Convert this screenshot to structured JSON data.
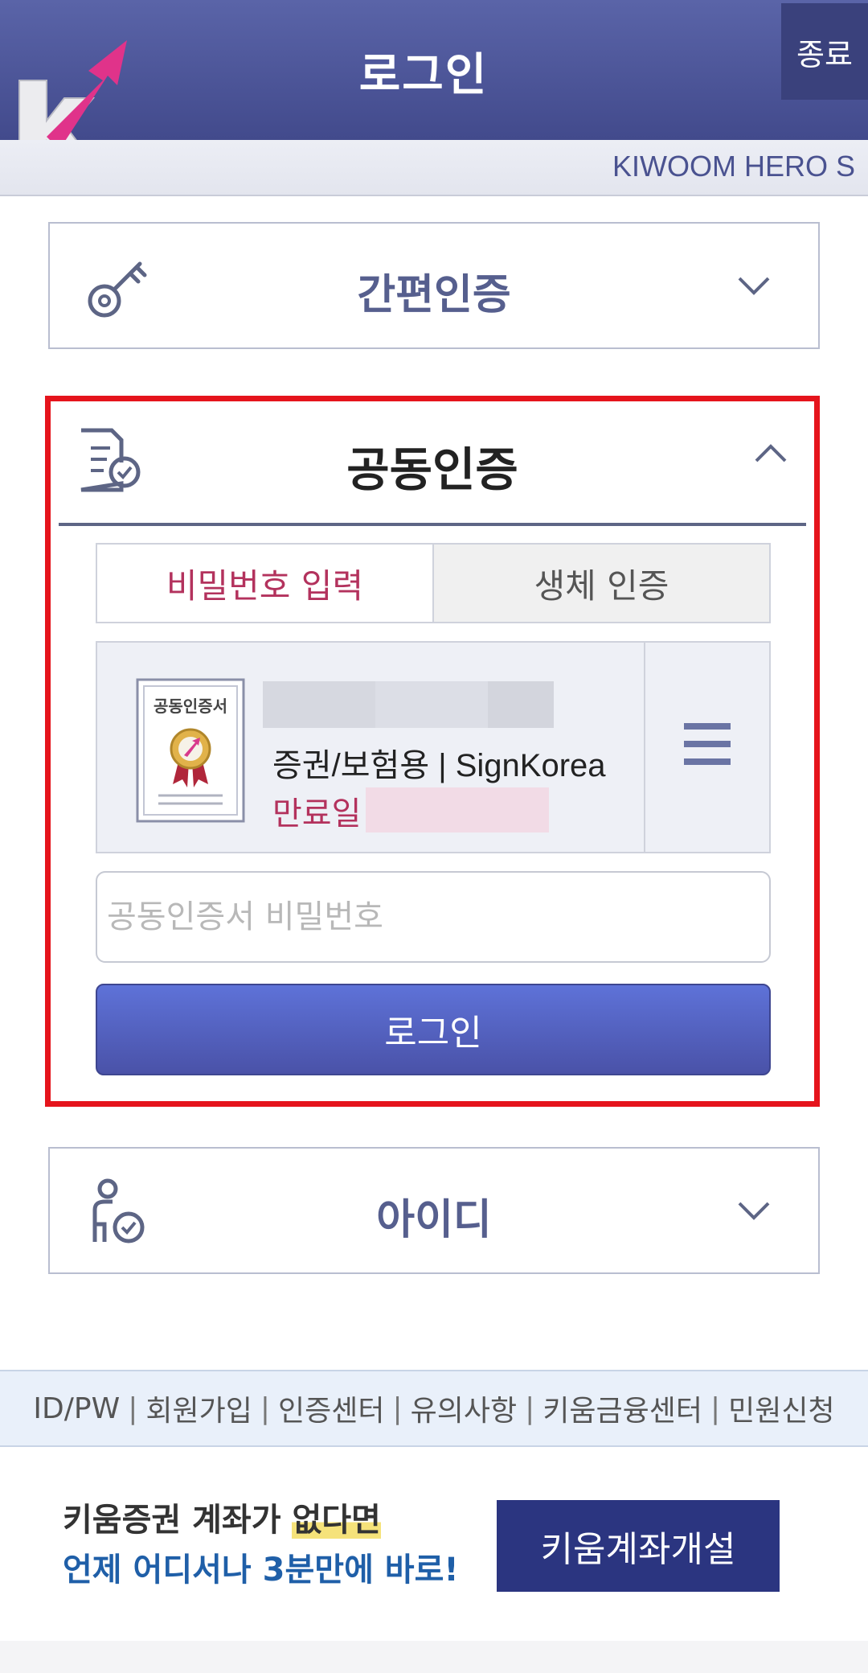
{
  "header": {
    "title": "로그인",
    "exit_label": "종료",
    "brand_text": "KIWOOM HERO S"
  },
  "sections": {
    "simple": {
      "title": "간편인증"
    },
    "joint": {
      "title": "공동인증",
      "tabs": [
        {
          "label": "비밀번호 입력",
          "active": true
        },
        {
          "label": "생체 인증",
          "active": false
        }
      ],
      "certificate": {
        "badge_text": "공동인증서",
        "type_text": "증권/보험용 | SignKorea",
        "expiry_label": "만료일"
      },
      "password_placeholder": "공동인증서 비밀번호",
      "login_label": "로그인"
    },
    "id": {
      "title": "아이디"
    }
  },
  "footer_links": [
    "ID/PW",
    "회원가입",
    "인증센터",
    "유의사항",
    "키움금융센터",
    "민원신청"
  ],
  "promo": {
    "line1_prefix": "키움증권 계좌가 ",
    "line1_highlight": "없다면",
    "line2": "언제 어디서나 3분만에 바로!",
    "button_label": "키움계좌개설"
  },
  "colors": {
    "header": "#4a5296",
    "accent_pink": "#b3325d",
    "highlight_border": "#e5141c",
    "login_button": "#5563c4"
  }
}
